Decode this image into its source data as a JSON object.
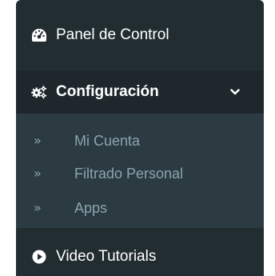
{
  "sidebar": {
    "items": [
      {
        "label": "Panel de Control",
        "icon": "tachometer-icon"
      },
      {
        "label": "Configuración",
        "icon": "cogs-icon",
        "expanded": true,
        "chevron": "chevron-down-icon"
      },
      {
        "label": "Video Tutorials",
        "icon": "play-circle-icon"
      }
    ],
    "submenu": [
      {
        "label": "Mi Cuenta",
        "icon": "double-chevron-right-icon"
      },
      {
        "label": "Filtrado Personal",
        "icon": "double-chevron-right-icon"
      },
      {
        "label": "Apps",
        "icon": "double-chevron-right-icon"
      }
    ]
  },
  "colors": {
    "sidebar_bg": "#222d32",
    "active_bg": "#1e282c",
    "submenu_bg": "#2c3b41",
    "submenu_text": "#8aa4af",
    "text": "#ffffff"
  }
}
